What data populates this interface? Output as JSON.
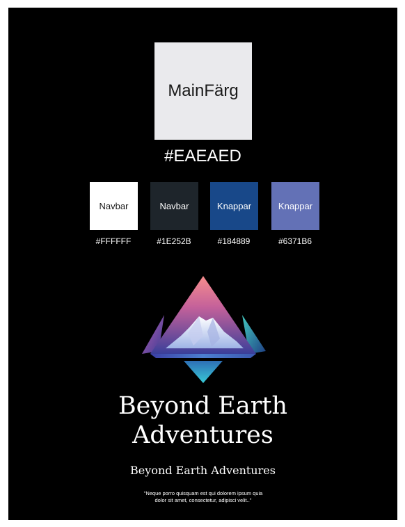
{
  "main_color": {
    "label": "MainFärg",
    "hex": "#EAEAED",
    "color": "#EAEAED"
  },
  "palette": [
    {
      "label": "Navbar",
      "hex": "#FFFFFF",
      "color": "#FFFFFF",
      "text_color": "#1a1a1a"
    },
    {
      "label": "Navbar",
      "hex": "#1E252B",
      "color": "#1E252B",
      "text_color": "#ffffff"
    },
    {
      "label": "Knappar",
      "hex": "#184889",
      "color": "#184889",
      "text_color": "#ffffff"
    },
    {
      "label": "Knappar",
      "hex": "#6371B6",
      "color": "#6371B6",
      "text_color": "#ffffff"
    }
  ],
  "brand": {
    "logo_icon": "mountain-triangle-logo",
    "title_line1": "Beyond Earth",
    "title_line2": "Adventures",
    "subtitle": "Beyond Earth Adventures",
    "quote_line1": "\"Neque porro quisquam est qui dolorem ipsum quia",
    "quote_line2": "dolor sit amet, consectetur, adipisci velit..\""
  }
}
